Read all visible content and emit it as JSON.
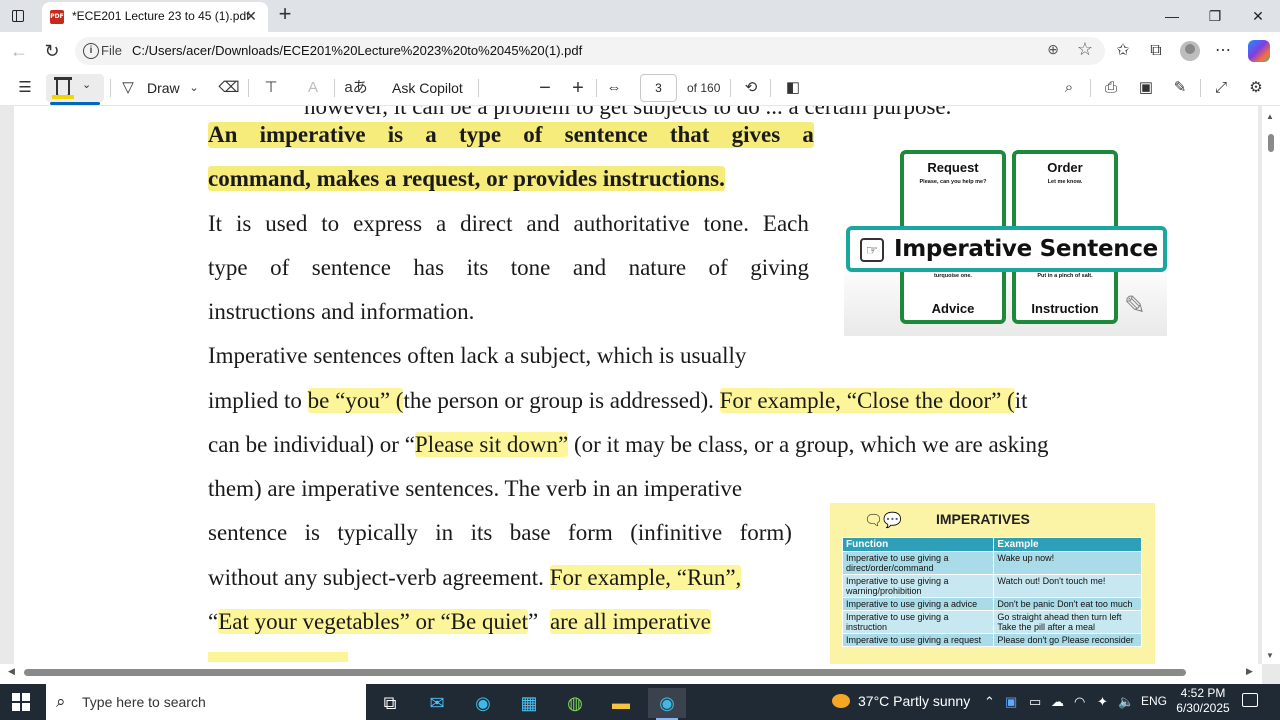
{
  "browser": {
    "tab_title": "*ECE201 Lecture 23 to 45 (1).pdf",
    "tab_badge": "PDF",
    "scheme_label": "File",
    "url": "C:/Users/acer/Downloads/ECE201%20Lecture%2023%20to%2045%20(1).pdf"
  },
  "pdf_toolbar": {
    "draw_label": "Draw",
    "ask_copilot_label": "Ask Copilot",
    "page_current": "3",
    "page_of": "of 160"
  },
  "document": {
    "cut_line": "however, it can be a problem to get subjects to do ... a certain purpose.",
    "def_line1_words": [
      "An",
      "imperative",
      "is",
      "a",
      "type",
      "of",
      "sentence",
      "that",
      "gives",
      "a"
    ],
    "def_line2": "command, makes a request, or provides instructions.",
    "para1_line1_words": [
      "It",
      "is",
      "used",
      "to",
      "express",
      "a",
      "direct",
      "and",
      "authoritative",
      "tone.",
      "Each"
    ],
    "para1_line2_words": [
      "type",
      "of",
      "sentence",
      "has",
      "its",
      "tone",
      "and",
      "nature",
      "of",
      "giving"
    ],
    "para1_line3": "instructions and information.",
    "para2_line1": "Imperative sentences often lack a subject, which is usually",
    "para2_line2_a": "implied to ",
    "para2_line2_hl1": "be “you” (",
    "para2_line2_b": "the person or group is addressed). ",
    "para2_line2_hl2": "For example, “Close the door” (",
    "para2_line2_c": "it",
    "para2_line3_a": "can be individual) or “",
    "para2_line3_hl": "Please sit down”",
    "para2_line3_b": " (or it may be class, or a group, which we are asking",
    "para2_line4": "them) are imperative sentences. The verb in an imperative",
    "para2_line5_words": [
      "sentence",
      "is",
      "typically",
      "in",
      "its",
      "base",
      "form",
      "(infinitive",
      "form)"
    ],
    "para2_line6_a": "without any subject-verb agreement. ",
    "para2_line6_hl": "For example, “Run”,",
    "para2_line7_a": "“",
    "para2_line7_hl1": "Eat your vegetables” or “Be quiet",
    "para2_line7_b": "” ",
    "para2_line7_hl2": "are all imperative"
  },
  "imperative_graphic": {
    "title": "Imperative Sentence",
    "boxes": [
      {
        "heading": "Request",
        "sample": "Please, can you help me?"
      },
      {
        "heading": "Order",
        "sample": "Let me know."
      },
      {
        "heading": "Advice",
        "sample": "Choose the red dress, not the turquoise one."
      },
      {
        "heading": "Instruction",
        "sample": "Put in a pinch of salt."
      }
    ]
  },
  "imperatives_table": {
    "title": "IMPERATIVES",
    "headers": [
      "Function",
      "Example"
    ],
    "rows": [
      [
        "Imperative to use giving a direct/order/command",
        "Wake up now!"
      ],
      [
        "Imperative to use giving a warning/prohibition",
        "Watch out! Don't touch me!"
      ],
      [
        "Imperative to use giving a advice",
        "Don't be panic Don't eat too much"
      ],
      [
        "Imperative to use giving a instruction",
        "Go straight ahead then turn left Take the pill after a meal"
      ],
      [
        "Imperative to use giving a request",
        "Please don't go Please reconsider"
      ]
    ]
  },
  "taskbar": {
    "search_placeholder": "Type here to search",
    "weather": "37°C  Partly sunny",
    "language": "ENG",
    "time": "4:52 PM",
    "date": "6/30/2025"
  }
}
